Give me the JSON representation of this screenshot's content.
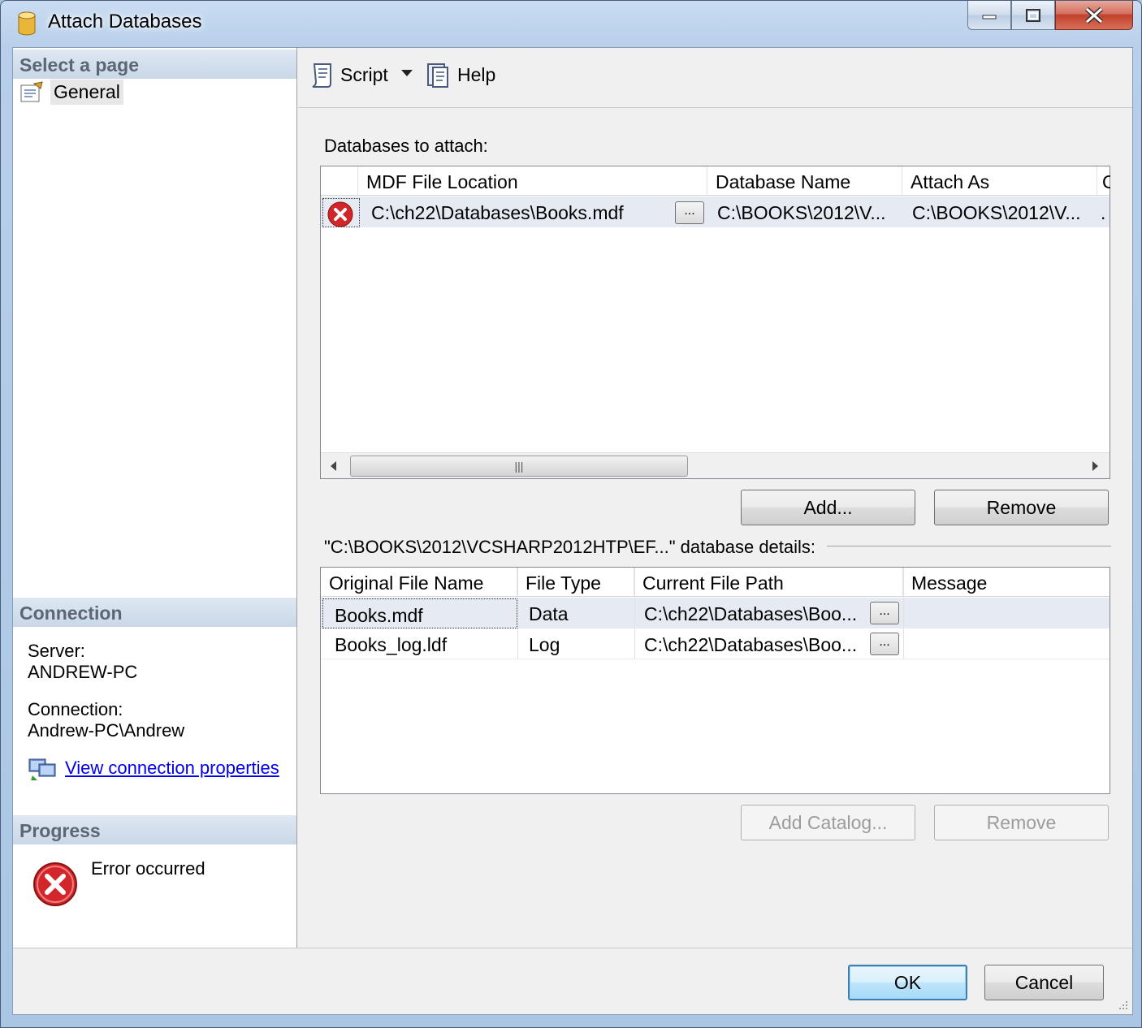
{
  "window": {
    "title": "Attach Databases"
  },
  "left": {
    "select_page_header": "Select a page",
    "pages": [
      {
        "label": "General"
      }
    ],
    "connection_header": "Connection",
    "server_label": "Server:",
    "server_value": "ANDREW-PC",
    "connection_label": "Connection:",
    "connection_value": "Andrew-PC\\Andrew",
    "view_connection_link": "View connection properties",
    "progress_header": "Progress",
    "progress_status": "Error occurred"
  },
  "toolbar": {
    "script_label": "Script",
    "help_label": "Help"
  },
  "attach": {
    "label": "Databases to attach:",
    "columns": [
      "MDF File Location",
      "Database Name",
      "Attach As",
      "O"
    ],
    "rows": [
      {
        "mdf": "C:\\ch22\\Databases\\Books.mdf",
        "dbname": "C:\\BOOKS\\2012\\V...",
        "attach_as": "C:\\BOOKS\\2012\\V...",
        "browse": "...",
        "extra": "."
      }
    ],
    "add_button": "Add...",
    "remove_button": "Remove"
  },
  "details": {
    "label": "\"C:\\BOOKS\\2012\\VCSHARP2012HTP\\EF...\" database details:",
    "columns": [
      "Original File Name",
      "File Type",
      "Current File Path",
      "Message"
    ],
    "rows": [
      {
        "name": "Books.mdf",
        "type": "Data",
        "path": "C:\\ch22\\Databases\\Boo...",
        "browse": "...",
        "message": ""
      },
      {
        "name": "Books_log.ldf",
        "type": "Log",
        "path": "C:\\ch22\\Databases\\Boo...",
        "browse": "...",
        "message": ""
      }
    ],
    "add_catalog_button": "Add Catalog...",
    "remove_button": "Remove"
  },
  "footer": {
    "ok_button": "OK",
    "cancel_button": "Cancel"
  },
  "colors": {
    "error_red": "#d3262b",
    "link": "#0000ee",
    "default_button": "#3c7fb1"
  }
}
